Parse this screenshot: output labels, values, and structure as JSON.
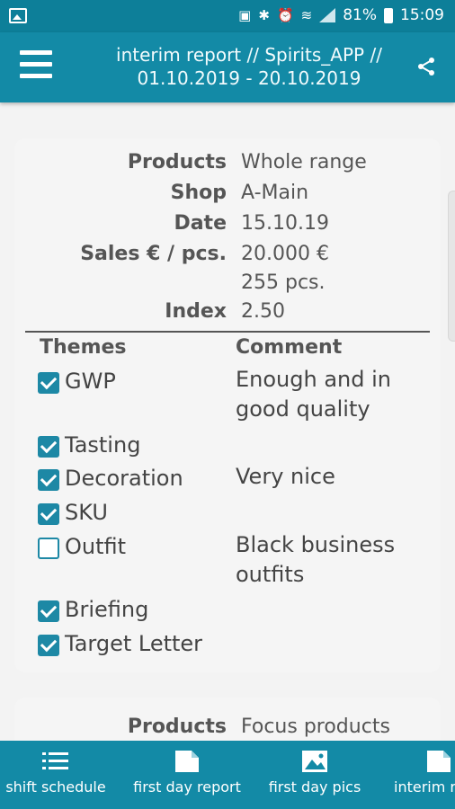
{
  "status_bar": {
    "battery": "81%",
    "time": "15:09"
  },
  "app_bar": {
    "title_line1": "interim report // Spirits_APP //",
    "title_line2": "01.10.2019 - 20.10.2019"
  },
  "report": {
    "products_label": "Products",
    "products_value": "Whole range",
    "shop_label": "Shop",
    "shop_value": "A-Main",
    "date_label": "Date",
    "date_value": "15.10.19",
    "sales_label": "Sales € / pcs.",
    "sales_value": "20.000 €",
    "pcs_value": "255 pcs.",
    "index_label": "Index",
    "index_value": "2.50",
    "themes_header": "Themes",
    "comment_header": "Comment",
    "themes": [
      {
        "name": "GWP",
        "checked": true,
        "comment_line1": "Enough and in",
        "comment_line2": "good quality"
      },
      {
        "name": "Tasting",
        "checked": true,
        "comment_line1": "",
        "comment_line2": ""
      },
      {
        "name": "Decoration",
        "checked": true,
        "comment_line1": "Very nice",
        "comment_line2": ""
      },
      {
        "name": "SKU",
        "checked": true,
        "comment_line1": "",
        "comment_line2": ""
      },
      {
        "name": "Outfit",
        "checked": false,
        "comment_line1": "Black business",
        "comment_line2": "outfits"
      },
      {
        "name": "Briefing",
        "checked": true,
        "comment_line1": "",
        "comment_line2": ""
      },
      {
        "name": "Target Letter",
        "checked": true,
        "comment_line1": "",
        "comment_line2": ""
      }
    ]
  },
  "report2": {
    "products_label": "Products",
    "products_value": "Focus products"
  },
  "bottom_nav": [
    {
      "label": "shift schedule",
      "icon": "list-icon"
    },
    {
      "label": "first day report",
      "icon": "note-icon"
    },
    {
      "label": "first day pics",
      "icon": "image-icon"
    },
    {
      "label": "interim re",
      "icon": "note-icon"
    }
  ],
  "colors": {
    "primary": "#138aa6",
    "status_bar": "#0d7f99",
    "checkbox": "#1d88a5"
  }
}
